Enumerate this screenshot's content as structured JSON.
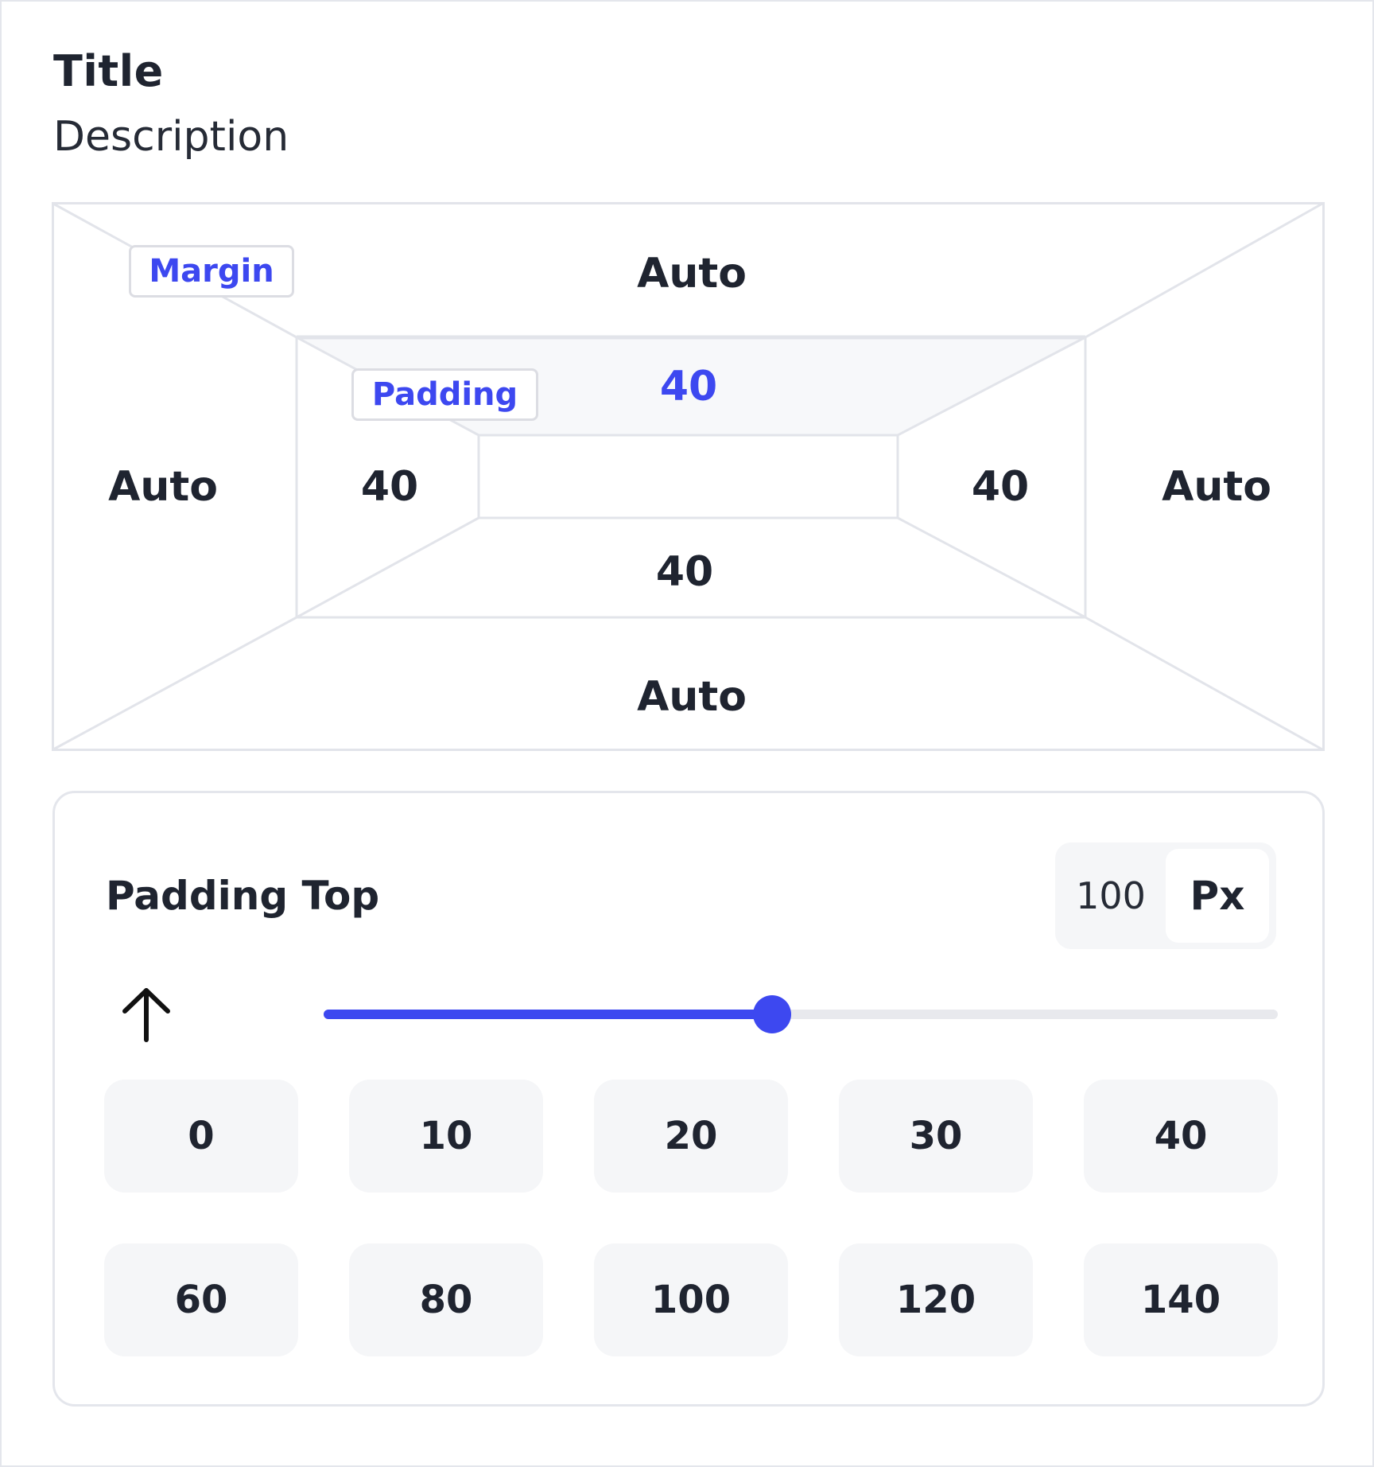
{
  "header": {
    "title": "Title",
    "description": "Description"
  },
  "box_model": {
    "margin_tag": "Margin",
    "padding_tag": "Padding",
    "margin": {
      "top": "Auto",
      "right": "Auto",
      "bottom": "Auto",
      "left": "Auto"
    },
    "padding": {
      "top": "40",
      "right": "40",
      "bottom": "40",
      "left": "40"
    },
    "active_side": "padding-top",
    "accent_color": "#3d48f0"
  },
  "control": {
    "label": "Padding Top",
    "value": "100",
    "unit": "Px",
    "slider_fraction": 0.47,
    "icon": "arrow-up-icon",
    "presets": [
      "0",
      "10",
      "20",
      "30",
      "40",
      "60",
      "80",
      "100",
      "120",
      "140"
    ]
  }
}
